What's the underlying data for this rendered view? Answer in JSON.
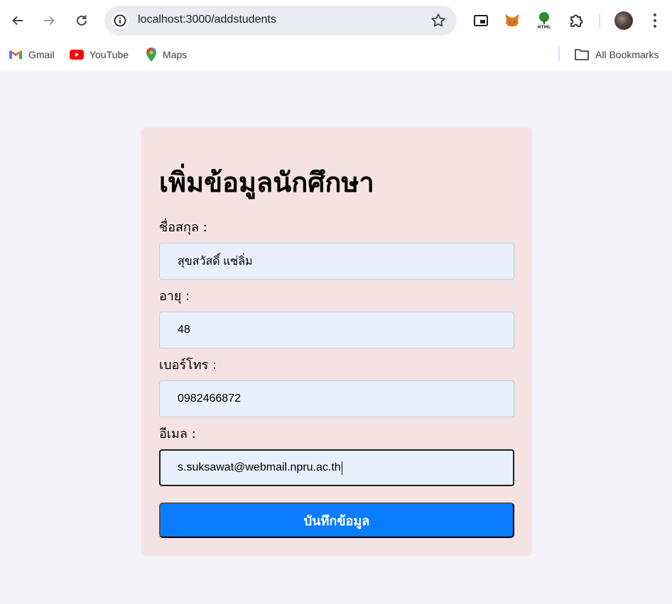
{
  "browser": {
    "url": "localhost:3000/addstudents",
    "bookmarks": [
      {
        "label": "Gmail",
        "icon": "gmail-icon"
      },
      {
        "label": "YouTube",
        "icon": "youtube-icon"
      },
      {
        "label": "Maps",
        "icon": "maps-icon"
      }
    ],
    "all_bookmarks_label": "All Bookmarks"
  },
  "form": {
    "title": "เพิ่มข้อมูลนักศึกษา",
    "fields": {
      "name": {
        "label": "ชื่อสกุล :",
        "value": "สุขสวัสดิ์  แซ่ลิ่ม"
      },
      "age": {
        "label": "อายุ :",
        "value": "48"
      },
      "phone": {
        "label": "เบอร์โทร :",
        "value": "0982466872"
      },
      "email": {
        "label": "อีเมล :",
        "value": "s.suksawat@webmail.npru.ac.th"
      }
    },
    "submit_label": "บันทึกข้อมูล"
  },
  "colors": {
    "page_bg": "#f3f3f8",
    "card_bg": "#f5e2e2",
    "field_bg": "#e8f0fe",
    "button_bg": "#0a7cff"
  }
}
